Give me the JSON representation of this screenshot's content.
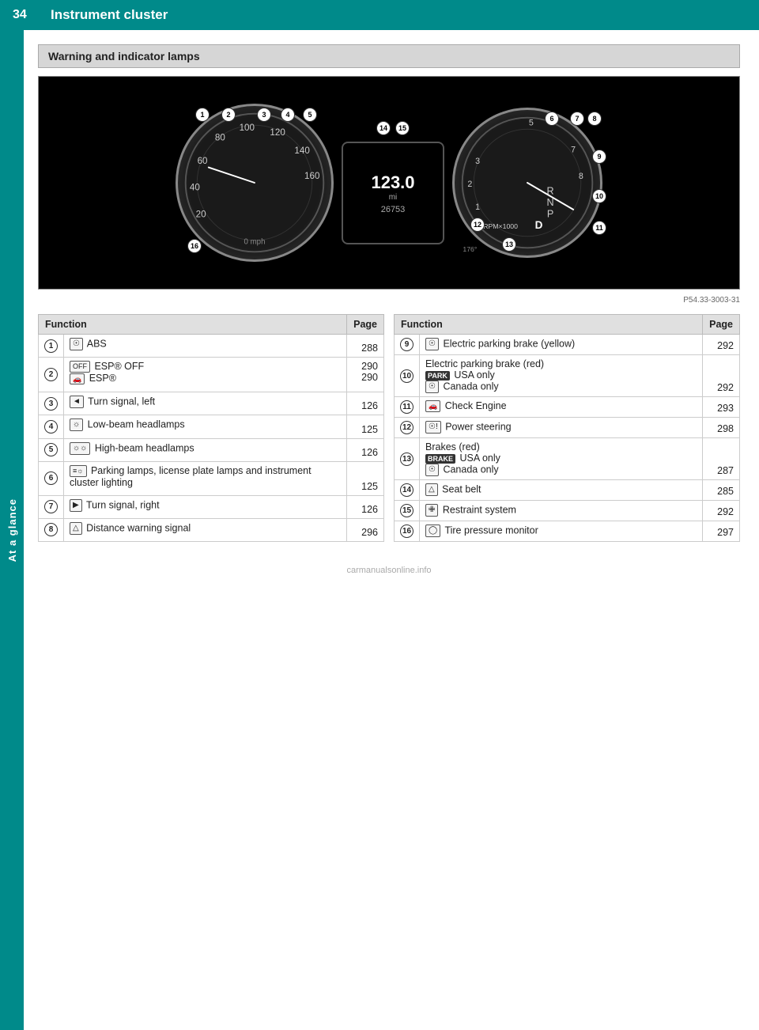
{
  "header": {
    "page_number": "34",
    "title": "Instrument cluster"
  },
  "sidebar": {
    "label": "At a glance"
  },
  "section": {
    "title": "Warning and indicator lamps"
  },
  "cluster": {
    "speed": "123.0",
    "speed_unit": "mi",
    "odometer": "26753",
    "image_ref": "P54.33-3003-31"
  },
  "table_left": {
    "col_function": "Function",
    "col_page": "Page",
    "rows": [
      {
        "num": "①",
        "icon": "⊙",
        "icon_label": "ABS",
        "function": "ABS",
        "page": "288"
      },
      {
        "num": "②",
        "icon": "ESP OFF / ESP®",
        "function_line1": "ESP® OFF",
        "function_line2": "ESP®",
        "page1": "290",
        "page2": "290"
      },
      {
        "num": "③",
        "icon": "◁",
        "function": "Turn signal, left",
        "page": "126"
      },
      {
        "num": "④",
        "icon": "D",
        "function": "Low-beam headlamps",
        "page": "125"
      },
      {
        "num": "⑤",
        "icon": "D",
        "function": "High-beam headlamps",
        "page": "126"
      },
      {
        "num": "⑥",
        "icon": "≡",
        "function": "Parking lamps, license plate lamps and instrument cluster lighting",
        "page": "125"
      },
      {
        "num": "⑦",
        "icon": "▷",
        "function": "Turn signal, right",
        "page": "126"
      },
      {
        "num": "⑧",
        "icon": "△",
        "function": "Distance warning signal",
        "page": "296"
      }
    ]
  },
  "table_right": {
    "col_function": "Function",
    "col_page": "Page",
    "rows": [
      {
        "num": "⑨",
        "icon": "⊙",
        "function": "Electric parking brake (yellow)",
        "page": "292"
      },
      {
        "num": "⑩",
        "function_line1": "Electric parking brake (red)",
        "function_line2": "USA only",
        "function_line3": "Canada only",
        "icon1": "PARK",
        "icon2": "⊙",
        "page": "292"
      },
      {
        "num": "⑪",
        "icon": "engine",
        "function": "Check Engine",
        "page": "293"
      },
      {
        "num": "⑫",
        "icon": "steering",
        "function": "Power steering",
        "page": "298"
      },
      {
        "num": "⑬",
        "function": "Brakes (red)",
        "function_line2": "USA only",
        "function_line3": "Canada only",
        "icon1": "BRAKE",
        "icon2": "⊙",
        "page": "287"
      },
      {
        "num": "⑭",
        "icon": "seatbelt",
        "function": "Seat belt",
        "page": "285"
      },
      {
        "num": "⑮",
        "icon": "restraint",
        "function": "Restraint system",
        "page": "292"
      },
      {
        "num": "⑯",
        "icon": "tire",
        "function": "Tire pressure monitor",
        "page": "297"
      }
    ]
  }
}
